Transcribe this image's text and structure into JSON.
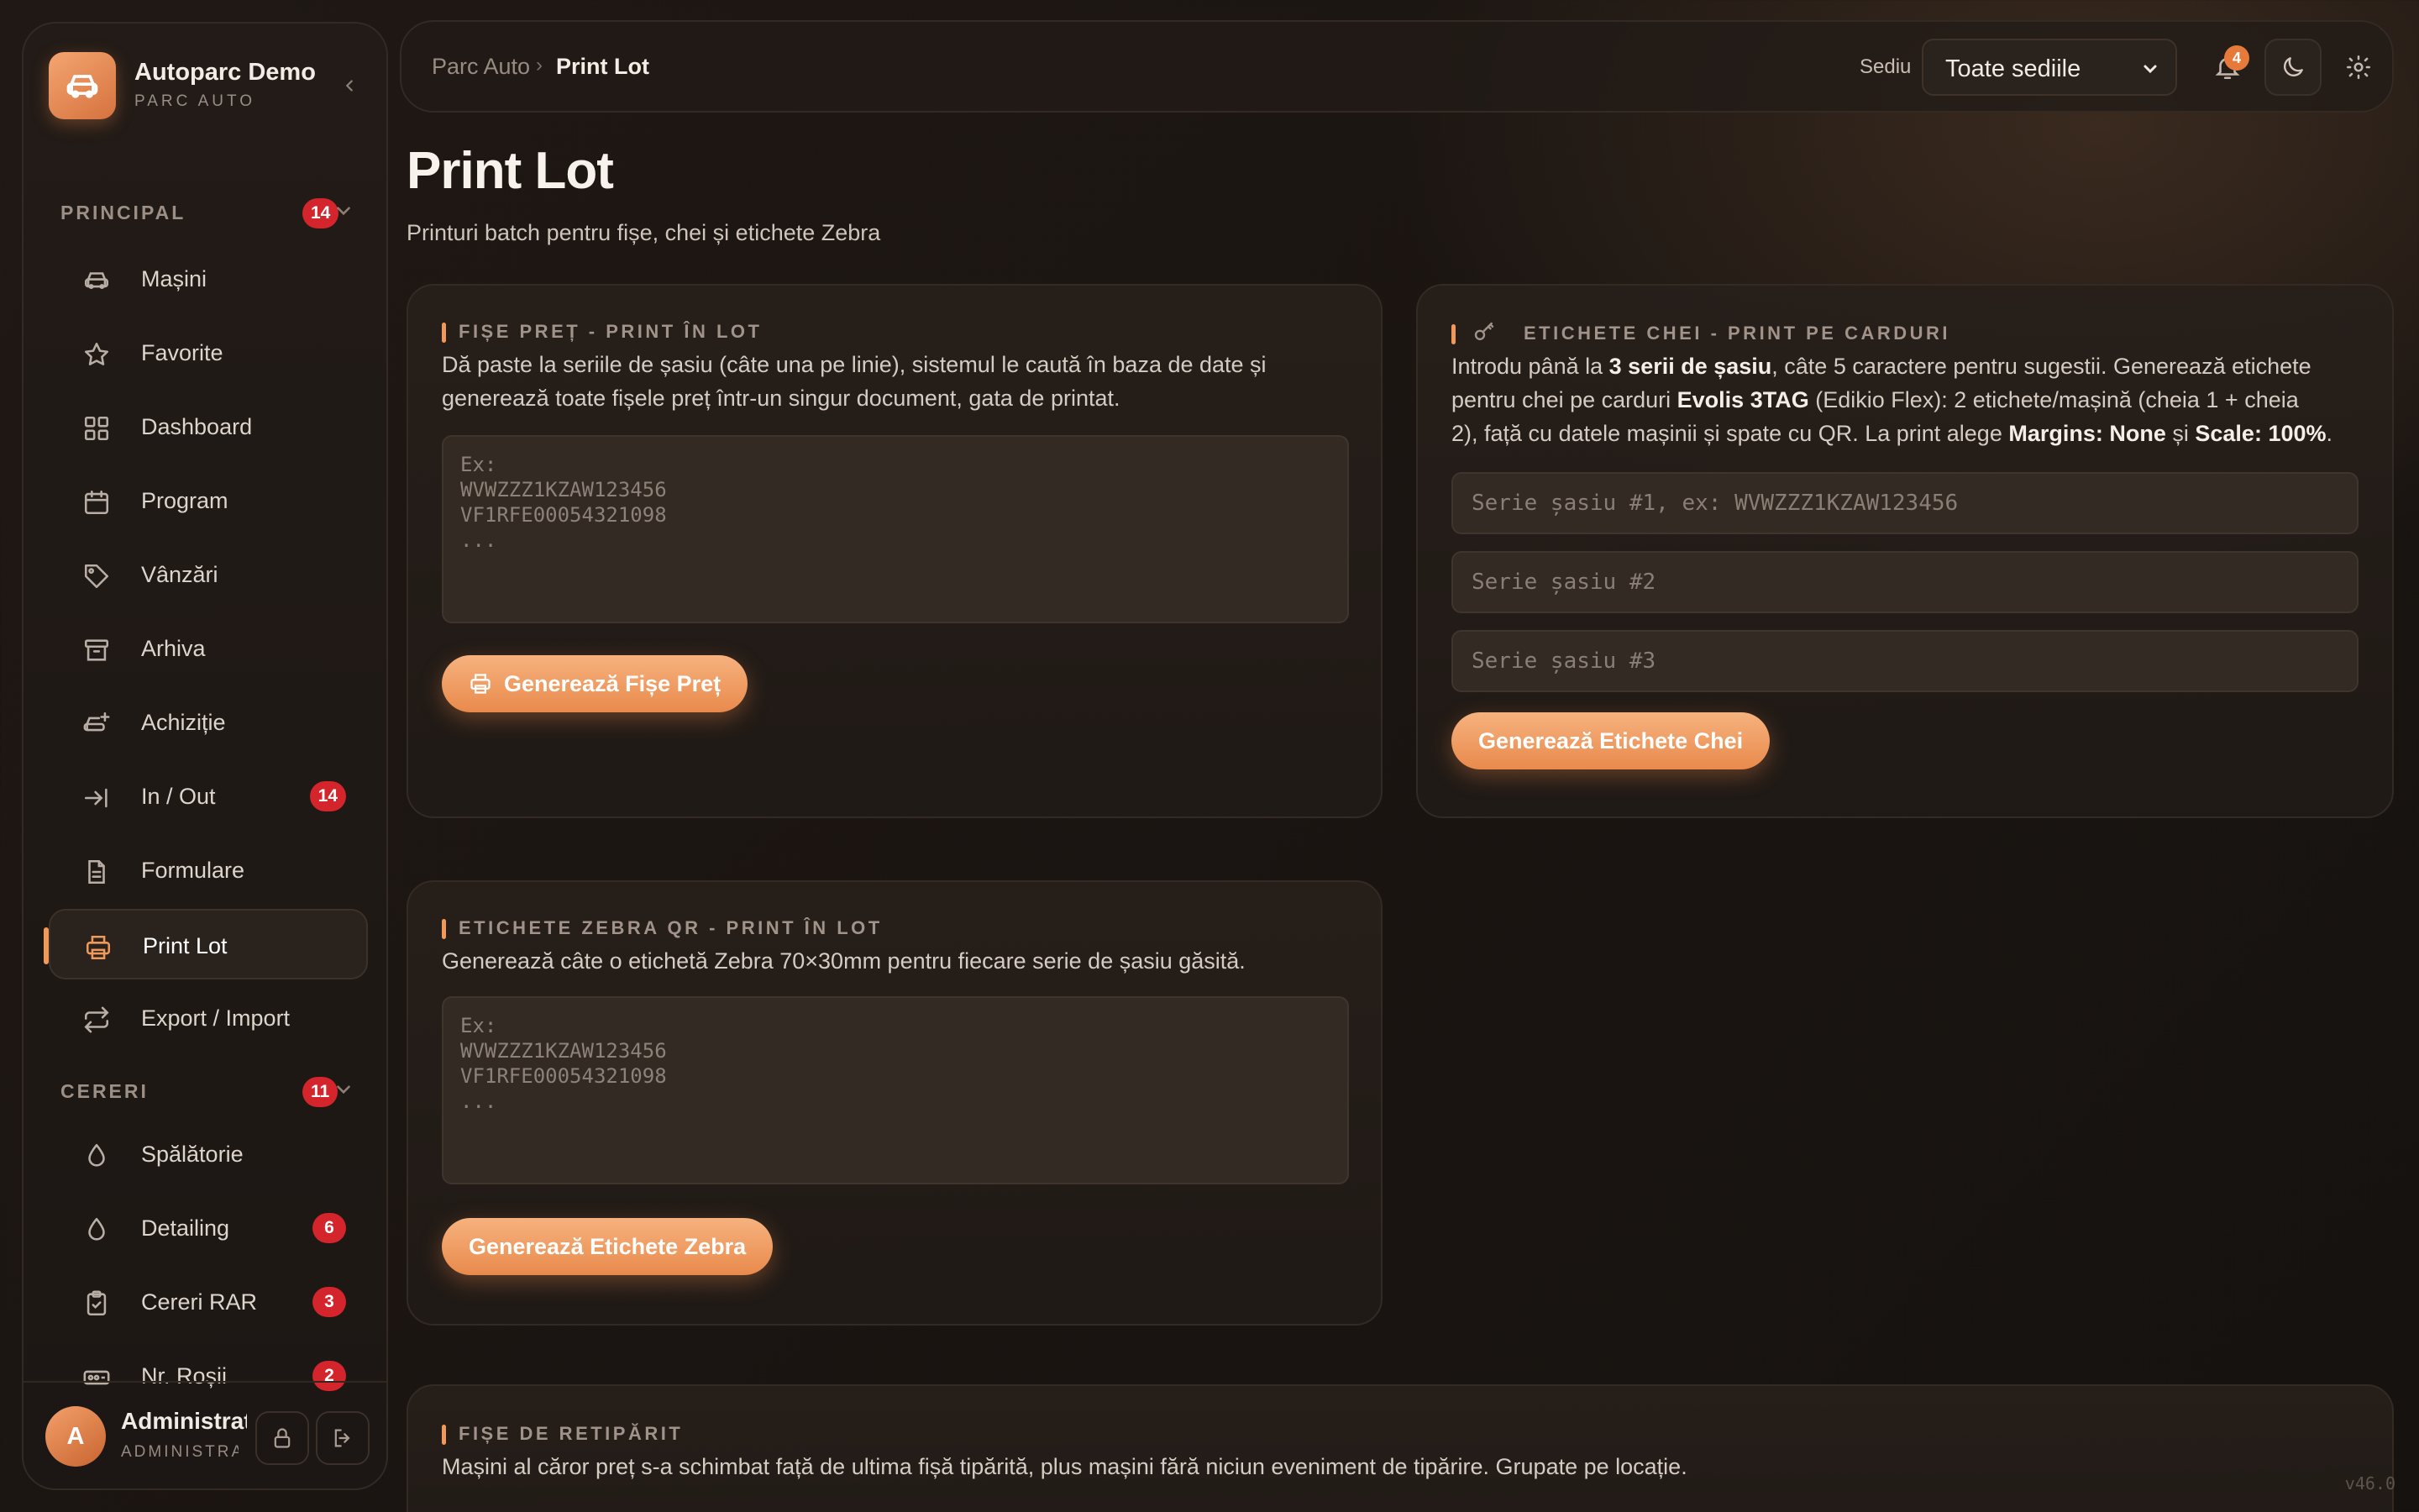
{
  "brand": {
    "name": "Autoparc Demo",
    "sub": "PARC AUTO"
  },
  "sidebar": {
    "principal": {
      "label": "PRINCIPAL",
      "count": "14"
    },
    "items": [
      {
        "label": "Mașini"
      },
      {
        "label": "Favorite"
      },
      {
        "label": "Dashboard"
      },
      {
        "label": "Program"
      },
      {
        "label": "Vânzări"
      },
      {
        "label": "Arhiva"
      },
      {
        "label": "Achiziție"
      },
      {
        "label": "In / Out",
        "badge": "14"
      },
      {
        "label": "Formulare"
      },
      {
        "label": "Print Lot"
      },
      {
        "label": "Export / Import"
      }
    ],
    "cereri": {
      "label": "CERERI",
      "count": "11"
    },
    "cereri_items": [
      {
        "label": "Spălătorie"
      },
      {
        "label": "Detailing",
        "badge": "6"
      },
      {
        "label": "Cereri RAR",
        "badge": "3"
      },
      {
        "label": "Nr. Roșii",
        "badge": "2"
      }
    ]
  },
  "user": {
    "initial": "A",
    "name": "Administrator",
    "role": "ADMINISTRATOR"
  },
  "topbar": {
    "crumb_root": "Parc Auto",
    "crumb_sep": "›",
    "crumb_current": "Print Lot",
    "sediu_label": "Sediu",
    "sediu_value": "Toate sediile",
    "notif_count": "4"
  },
  "page": {
    "title": "Print Lot",
    "subtitle": "Printuri batch pentru fișe, chei și etichete Zebra"
  },
  "fise_pret": {
    "title": "FIȘE PREȚ - PRINT ÎN LOT",
    "desc_1": "Dă paste la seriile de șasiu (câte una pe linie), sistemul le caută în baza de date și",
    "desc_2": "generează toate fișele preț într-un singur document, gata de printat.",
    "placeholder": "Ex:\nWVWZZZ1KZAW123456\nVF1RFE00054321098\n...",
    "button": "Generează Fișe Preț"
  },
  "etichete_chei": {
    "title": "ETICHETE CHEI - PRINT PE CARDURI",
    "l1_a": "Introdu până la ",
    "l1_b": "3 serii de șasiu",
    "l1_c": ", câte 5 caractere pentru sugestii. Generează etichete",
    "l2_a": "pentru chei pe carduri ",
    "l2_b": "Evolis 3TAG",
    "l2_c": " (Edikio Flex): 2 etichete/mașină (cheia 1 + cheia",
    "l3_a": "2), față cu datele mașinii și spate cu QR. La print alege ",
    "l3_b": "Margins: None",
    "l3_c": " și ",
    "l3_d": "Scale: 100%",
    "l3_e": ".",
    "input_1": "Serie șasiu #1, ex: WVWZZZ1KZAW123456",
    "input_2": "Serie șasiu #2",
    "input_3": "Serie șasiu #3",
    "button": "Generează Etichete Chei"
  },
  "zebra": {
    "title": "ETICHETE ZEBRA QR - PRINT ÎN LOT",
    "desc": "Generează câte o etichetă Zebra 70×30mm pentru fiecare serie de șasiu găsită.",
    "placeholder": "Ex:\nWVWZZZ1KZAW123456\nVF1RFE00054321098\n...",
    "button": "Generează Etichete Zebra"
  },
  "retiparit": {
    "title": "FIȘE DE RETIPĂRIT",
    "desc": "Mașini al căror preț s-a schimbat față de ultima fișă tipărită, plus mașini fără niciun eveniment de tipărire. Grupate pe locație."
  },
  "version": "v46.0",
  "colors": {
    "accent": "#f0995a",
    "badge": "#d3252b",
    "bg": "#1a1512"
  }
}
